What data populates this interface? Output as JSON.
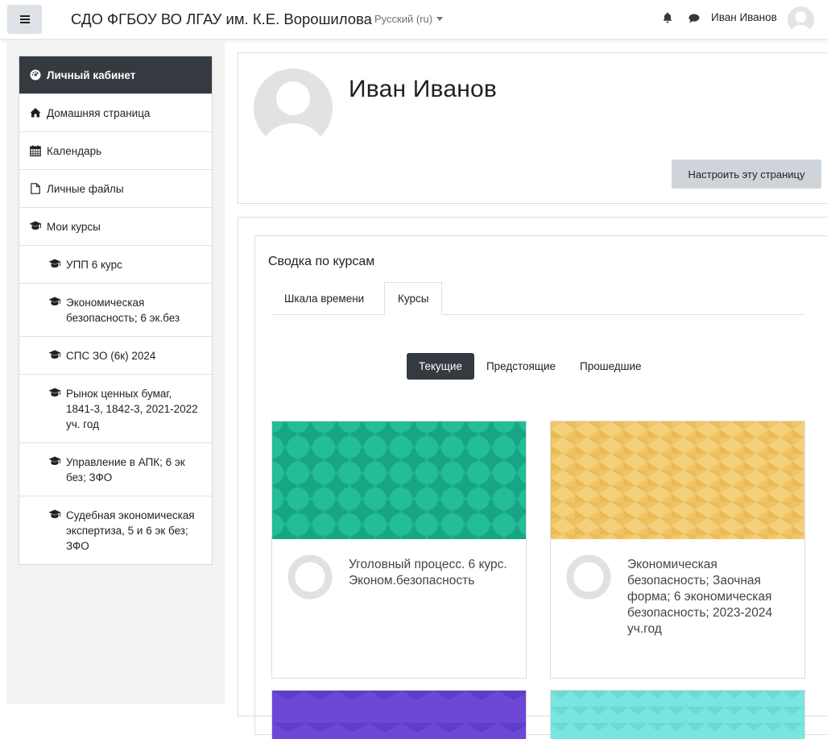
{
  "navbar": {
    "site_title": "СДО ФГБОУ ВО ЛГАУ им. К.Е. Ворошилова",
    "language": "Русский (ru)",
    "username": "Иван Иванов"
  },
  "drawer": {
    "items": [
      {
        "label": "Личный кабинет",
        "icon": "dashboard-icon",
        "active": true
      },
      {
        "label": "Домашняя страница",
        "icon": "home-icon"
      },
      {
        "label": "Календарь",
        "icon": "calendar-icon"
      },
      {
        "label": "Личные файлы",
        "icon": "file-icon"
      },
      {
        "label": "Мои курсы",
        "icon": "graduation-cap-icon"
      },
      {
        "label": "УПП 6 курс",
        "icon": "graduation-cap-icon",
        "sub": true
      },
      {
        "label": "Экономическая безопасность; 6 эк.без",
        "icon": "graduation-cap-icon",
        "sub": true
      },
      {
        "label": "СПС ЗО (6к) 2024",
        "icon": "graduation-cap-icon",
        "sub": true
      },
      {
        "label": "Рынок ценных бумаг, 1841-3, 1842-3, 2021-2022 уч. год",
        "icon": "graduation-cap-icon",
        "sub": true
      },
      {
        "label": "Управление в АПК; 6 эк без; ЗФО",
        "icon": "graduation-cap-icon",
        "sub": true
      },
      {
        "label": "Судебная экономическая экспертиза, 5 и 6 эк без; ЗФО",
        "icon": "graduation-cap-icon",
        "sub": true
      }
    ]
  },
  "profile": {
    "name": "Иван Иванов",
    "customize_label": "Настроить эту страницу"
  },
  "overview": {
    "title": "Сводка по курсам",
    "tabs": [
      "Шкала времени",
      "Курсы"
    ],
    "filters": [
      "Текущие",
      "Предстоящие",
      "Прошедшие"
    ],
    "courses": [
      {
        "name": "Уголовный процесс. 6 курс. Эконом.безопасность",
        "progress": "0%",
        "color": "#1bae8c"
      },
      {
        "name": "Экономическая безопасность; Заочная форма; 6 экономическая безопасность; 2023-2024 уч.год",
        "progress": "0%",
        "color": "#f2c66a"
      }
    ]
  },
  "colors": {
    "active_nav": "#343a40",
    "button_gray": "#ced4da",
    "drawer_bg": "#f2f2f2"
  }
}
